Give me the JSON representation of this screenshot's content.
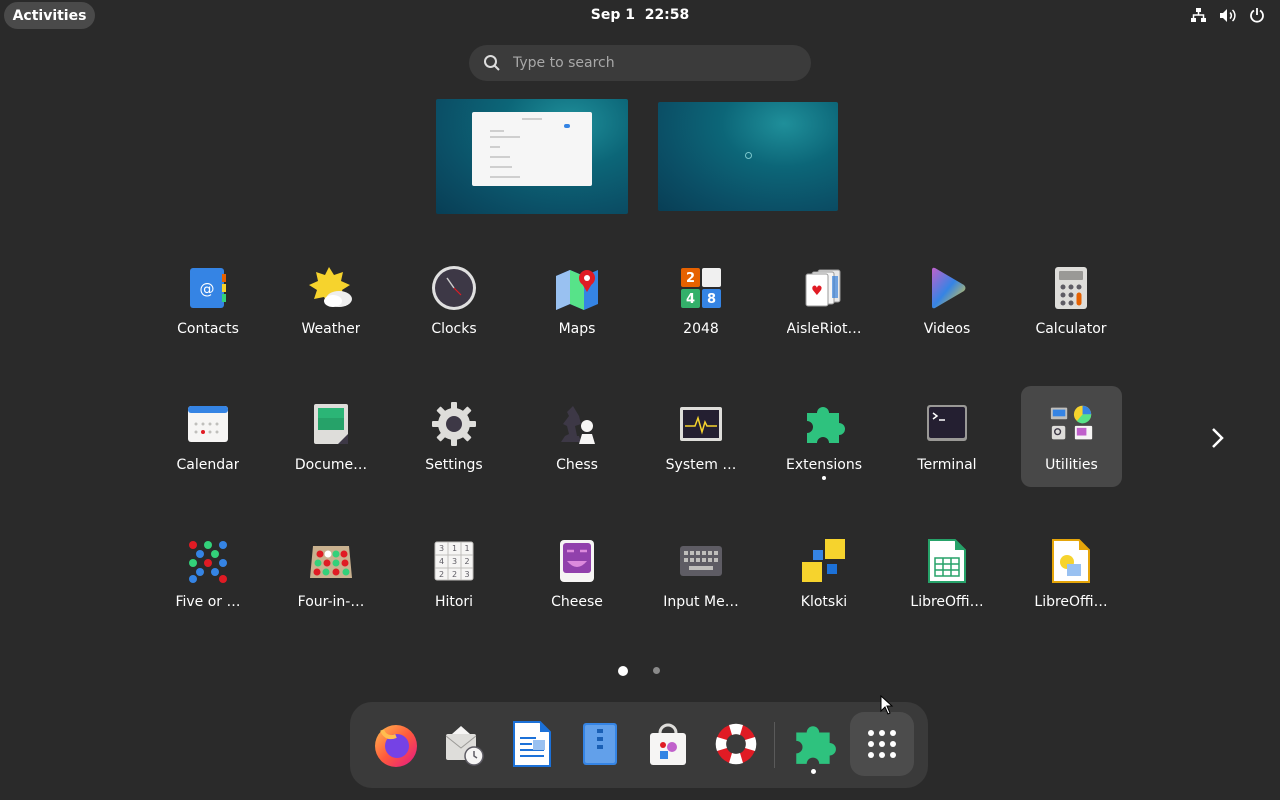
{
  "topbar": {
    "activities_label": "Activities",
    "clock": "Sep 1  22:58",
    "tray_icons": [
      "network-icon",
      "volume-icon",
      "power-icon"
    ]
  },
  "search": {
    "placeholder": "Type to search"
  },
  "workspaces": [
    {
      "name": "workspace-1",
      "has_window": true
    },
    {
      "name": "workspace-2",
      "has_window": false
    }
  ],
  "apps": [
    {
      "label": "Contacts",
      "icon": "contacts-icon"
    },
    {
      "label": "Weather",
      "icon": "weather-icon"
    },
    {
      "label": "Clocks",
      "icon": "clocks-icon"
    },
    {
      "label": "Maps",
      "icon": "maps-icon"
    },
    {
      "label": "2048",
      "icon": "2048-icon"
    },
    {
      "label": "AisleRiot…",
      "icon": "aisleriot-icon"
    },
    {
      "label": "Videos",
      "icon": "videos-icon"
    },
    {
      "label": "Calculator",
      "icon": "calculator-icon"
    },
    {
      "label": "Calendar",
      "icon": "calendar-icon"
    },
    {
      "label": "Docume…",
      "icon": "document-viewer-icon"
    },
    {
      "label": "Settings",
      "icon": "settings-icon"
    },
    {
      "label": "Chess",
      "icon": "chess-icon"
    },
    {
      "label": "System …",
      "icon": "system-monitor-icon"
    },
    {
      "label": "Extensions",
      "icon": "extensions-icon",
      "running": true
    },
    {
      "label": "Terminal",
      "icon": "terminal-icon"
    },
    {
      "label": "Utilities",
      "icon": "utilities-folder-icon",
      "selected": true
    },
    {
      "label": "Five or …",
      "icon": "five-or-more-icon"
    },
    {
      "label": "Four-in-…",
      "icon": "four-in-a-row-icon"
    },
    {
      "label": "Hitori",
      "icon": "hitori-icon"
    },
    {
      "label": "Cheese",
      "icon": "cheese-icon"
    },
    {
      "label": "Input Me…",
      "icon": "input-method-icon"
    },
    {
      "label": "Klotski",
      "icon": "klotski-icon"
    },
    {
      "label": "LibreOffi…",
      "icon": "libreoffice-calc-icon"
    },
    {
      "label": "LibreOffi…",
      "icon": "libreoffice-draw-icon"
    }
  ],
  "pagination": {
    "current_page": 1,
    "total_pages": 2
  },
  "dock": [
    {
      "name": "firefox",
      "icon": "firefox-icon"
    },
    {
      "name": "evolution",
      "icon": "mail-clock-icon"
    },
    {
      "name": "writer",
      "icon": "libreoffice-writer-icon"
    },
    {
      "name": "files",
      "icon": "files-icon"
    },
    {
      "name": "software",
      "icon": "software-store-icon"
    },
    {
      "name": "help",
      "icon": "help-lifebuoy-icon"
    },
    {
      "name": "extensions",
      "icon": "extensions-icon",
      "running": true
    },
    {
      "name": "show-apps",
      "icon": "app-grid-icon",
      "active": true
    }
  ],
  "colors": {
    "background": "#2a2a2a",
    "dock": "#3a3a3a",
    "selected": "#484848",
    "accent": "#3584e4"
  }
}
